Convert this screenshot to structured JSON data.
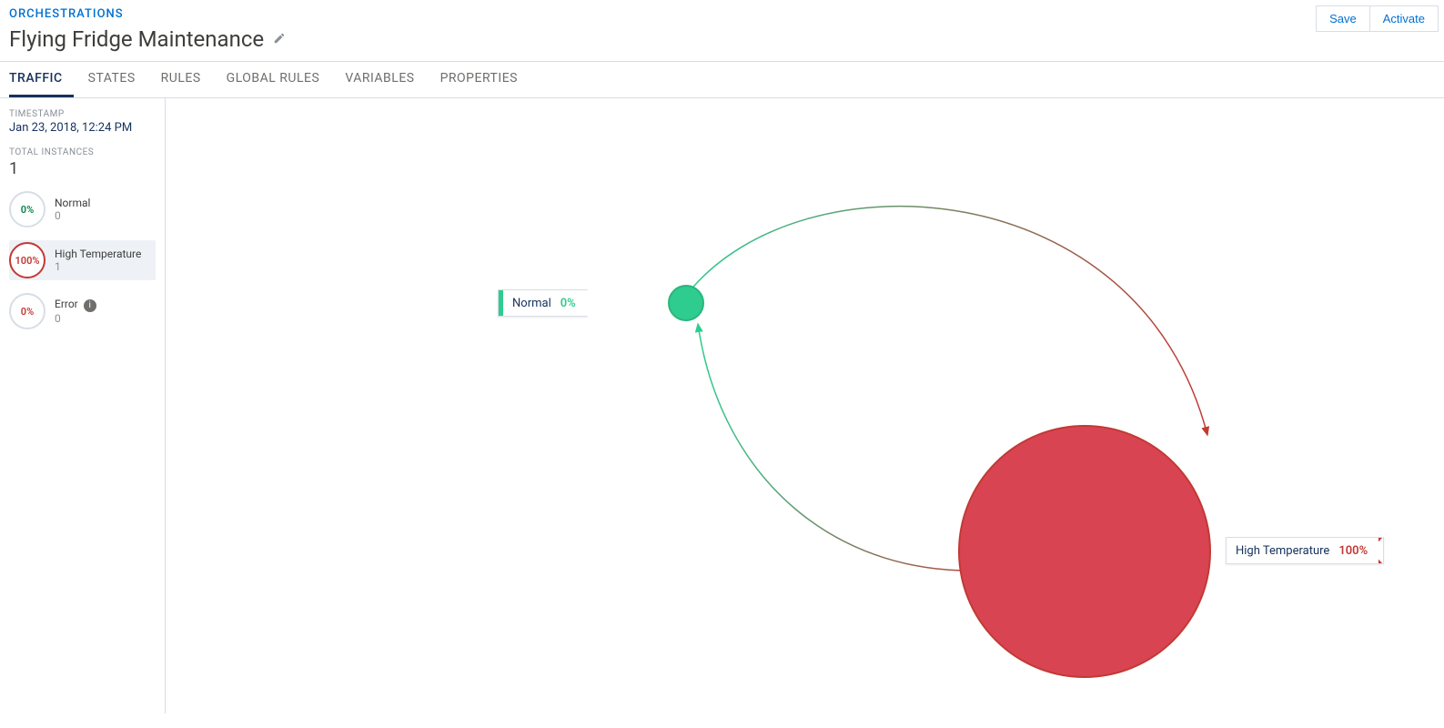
{
  "breadcrumb": "ORCHESTRATIONS",
  "title": "Flying Fridge Maintenance",
  "buttons": {
    "save": "Save",
    "activate": "Activate"
  },
  "tabs": [
    "TRAFFIC",
    "STATES",
    "RULES",
    "GLOBAL RULES",
    "VARIABLES",
    "PROPERTIES"
  ],
  "active_tab": "TRAFFIC",
  "sidebar": {
    "timestamp_label": "TIMESTAMP",
    "timestamp": "Jan 23, 2018, 12:24 PM",
    "total_label": "TOTAL INSTANCES",
    "total": "1",
    "states": [
      {
        "name": "Normal",
        "pct": "0%",
        "count": "0",
        "color": "green",
        "selected": false
      },
      {
        "name": "High Temperature",
        "pct": "100%",
        "count": "1",
        "color": "red",
        "selected": true
      },
      {
        "name": "Error",
        "pct": "0%",
        "count": "0",
        "color": "red-text",
        "selected": false,
        "info": true
      }
    ]
  },
  "nodes": {
    "normal": {
      "label": "Normal",
      "pct": "0%"
    },
    "high": {
      "label": "High Temperature",
      "pct": "100%"
    }
  },
  "chart_data": {
    "type": "state-diagram",
    "states": [
      {
        "id": "normal",
        "label": "Normal",
        "percent": 0,
        "count": 0,
        "color": "#2ecc8f"
      },
      {
        "id": "high",
        "label": "High Temperature",
        "percent": 100,
        "count": 1,
        "color": "#d94452"
      }
    ],
    "transitions": [
      {
        "from": "normal",
        "to": "high"
      },
      {
        "from": "high",
        "to": "normal"
      }
    ]
  }
}
